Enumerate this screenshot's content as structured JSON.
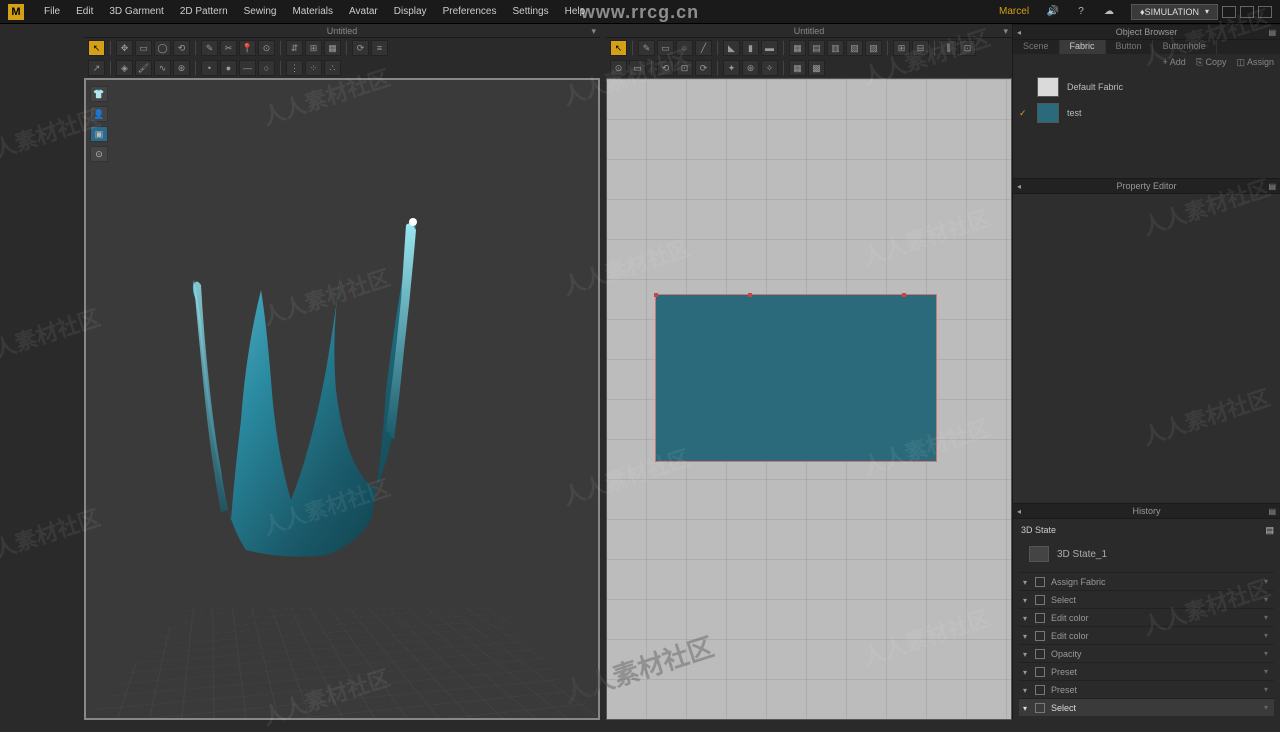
{
  "menu": {
    "items": [
      "File",
      "Edit",
      "3D Garment",
      "2D Pattern",
      "Sewing",
      "Materials",
      "Avatar",
      "Display",
      "Preferences",
      "Settings",
      "Help"
    ]
  },
  "user": "Marcel",
  "sim_button": "SIMULATION",
  "tab_left": "Untitled",
  "tab_right": "Untitled",
  "browser": {
    "title": "Object Browser",
    "tabs": [
      "Scene",
      "Fabric",
      "Button",
      "Buttonhole"
    ],
    "active_tab": "Fabric",
    "actions": {
      "add": "+ Add",
      "copy": "⎘ Copy",
      "assign": "◫ Assign"
    },
    "fabrics": [
      {
        "name": "Default Fabric",
        "color": "#dadada",
        "checked": false
      },
      {
        "name": "test",
        "color": "#2a6a7a",
        "checked": true
      }
    ]
  },
  "property": {
    "title": "Property Editor"
  },
  "history": {
    "title": "History",
    "section": "3D State",
    "state_item": "3D State_1",
    "rows": [
      "Assign Fabric",
      "Select",
      "Edit color",
      "Edit color",
      "Opacity",
      "Preset",
      "Preset",
      "Select"
    ]
  },
  "watermark": {
    "top": "www.rrcg.cn",
    "diag": "人人素材社区"
  },
  "colors": {
    "cloth": "#2a8aa0",
    "pattern": "#2a6a7a"
  }
}
